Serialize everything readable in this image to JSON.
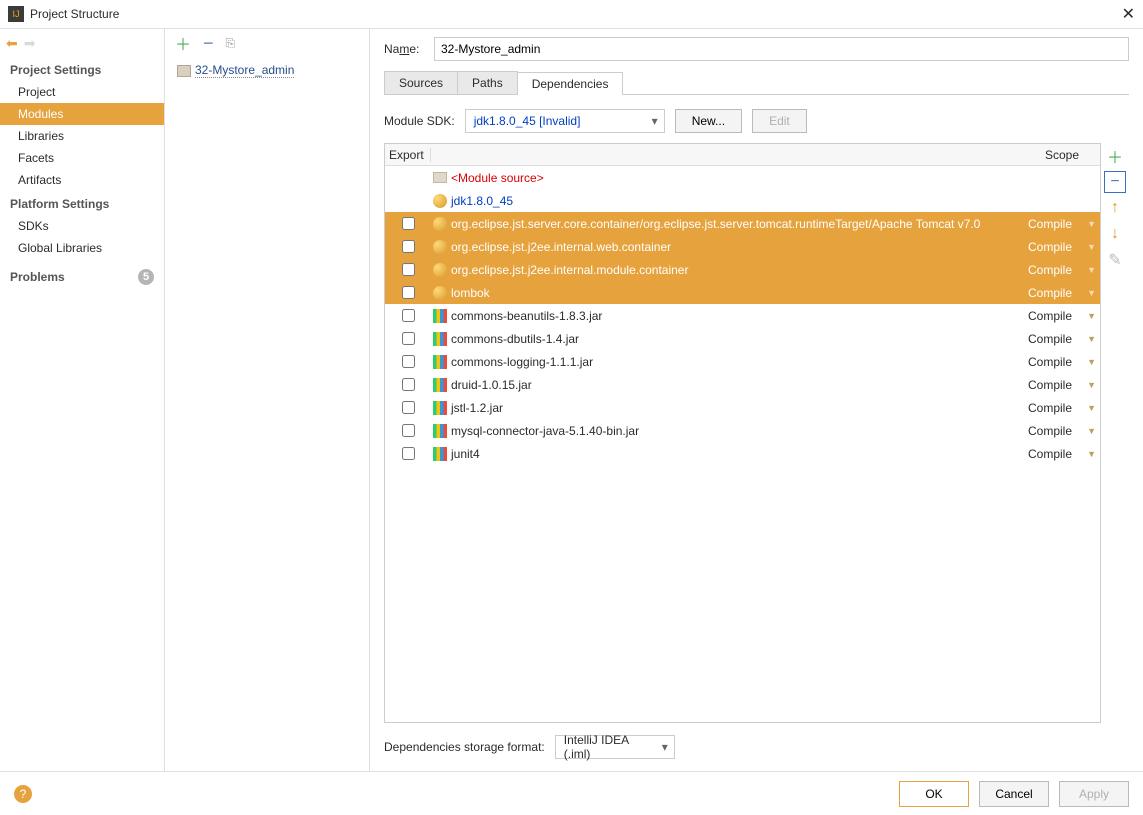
{
  "window": {
    "title": "Project Structure"
  },
  "sidebar": {
    "projectSettings": "Project Settings",
    "items": [
      "Project",
      "Modules",
      "Libraries",
      "Facets",
      "Artifacts"
    ],
    "selectedIndex": 1,
    "platformSettings": "Platform Settings",
    "platformItems": [
      "SDKs",
      "Global Libraries"
    ],
    "problems": "Problems",
    "problemCount": "5"
  },
  "moduleTree": {
    "module": "32-Mystore_admin"
  },
  "details": {
    "nameLabel": "Name:",
    "nameValue": "32-Mystore_admin",
    "tabs": [
      "Sources",
      "Paths",
      "Dependencies"
    ],
    "activeTab": 2,
    "sdkLabel": "Module SDK:",
    "sdkValue": "jdk1.8.0_45 [Invalid]",
    "newBtn": "New...",
    "editBtn": "Edit",
    "headers": {
      "export": "Export",
      "scope": "Scope"
    },
    "rows": [
      {
        "kind": "modsrc",
        "name": "<Module source>",
        "scope": "",
        "cb": false,
        "sel": false
      },
      {
        "kind": "sdk",
        "name": "jdk1.8.0_45",
        "scope": "",
        "cb": false,
        "sel": false
      },
      {
        "kind": "lib",
        "name": "org.eclipse.jst.server.core.container/org.eclipse.jst.server.tomcat.runtimeTarget/Apache Tomcat v7.0",
        "scope": "Compile",
        "cb": true,
        "sel": true
      },
      {
        "kind": "lib",
        "name": "org.eclipse.jst.j2ee.internal.web.container",
        "scope": "Compile",
        "cb": true,
        "sel": true
      },
      {
        "kind": "lib",
        "name": "org.eclipse.jst.j2ee.internal.module.container",
        "scope": "Compile",
        "cb": true,
        "sel": true
      },
      {
        "kind": "lib",
        "name": "lombok",
        "scope": "Compile",
        "cb": true,
        "sel": true
      },
      {
        "kind": "jar",
        "name": "commons-beanutils-1.8.3.jar",
        "scope": "Compile",
        "cb": true,
        "sel": false
      },
      {
        "kind": "jar",
        "name": "commons-dbutils-1.4.jar",
        "scope": "Compile",
        "cb": true,
        "sel": false
      },
      {
        "kind": "jar",
        "name": "commons-logging-1.1.1.jar",
        "scope": "Compile",
        "cb": true,
        "sel": false
      },
      {
        "kind": "jar",
        "name": "druid-1.0.15.jar",
        "scope": "Compile",
        "cb": true,
        "sel": false
      },
      {
        "kind": "jar",
        "name": "jstl-1.2.jar",
        "scope": "Compile",
        "cb": true,
        "sel": false
      },
      {
        "kind": "jar",
        "name": "mysql-connector-java-5.1.40-bin.jar",
        "scope": "Compile",
        "cb": true,
        "sel": false
      },
      {
        "kind": "jar",
        "name": "junit4",
        "scope": "Compile",
        "cb": true,
        "sel": false
      }
    ],
    "storageLabel": "Dependencies storage format:",
    "storageValue": "IntelliJ IDEA (.iml)"
  },
  "footer": {
    "ok": "OK",
    "cancel": "Cancel",
    "apply": "Apply"
  }
}
